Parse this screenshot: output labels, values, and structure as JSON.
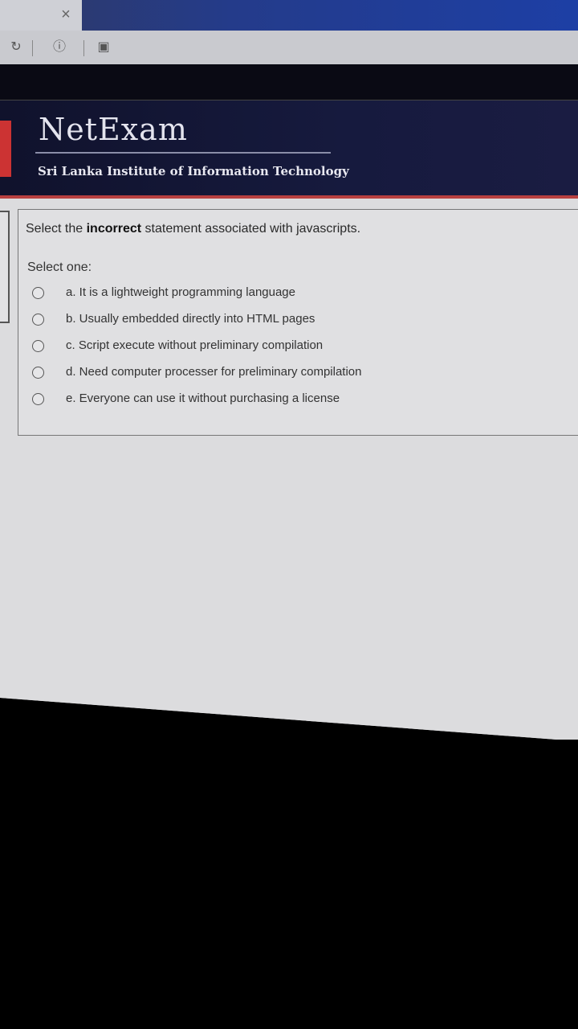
{
  "browser": {
    "tab_close_glyph": "×",
    "reload_glyph": "↻",
    "info_glyph": "ⓘ",
    "extension_glyph": "▣"
  },
  "header": {
    "brand": "NetExam",
    "institute": "Sri Lanka Institute of Information Technology"
  },
  "question": {
    "prefix": "Select the ",
    "emphasis": "incorrect",
    "suffix": " statement associated with javascripts.",
    "select_label": "Select one:",
    "options": [
      {
        "label": "a. It is a lightweight programming language"
      },
      {
        "label": "b. Usually embedded directly into HTML pages"
      },
      {
        "label": "c. Script execute without preliminary compilation"
      },
      {
        "label": "d. Need computer processer for preliminary compilation"
      },
      {
        "label": "e. Everyone can use it without purchasing a license"
      }
    ]
  },
  "colors": {
    "header_bg": "#10122c",
    "accent_red": "#b84040",
    "page_bg": "#dcdcde"
  }
}
